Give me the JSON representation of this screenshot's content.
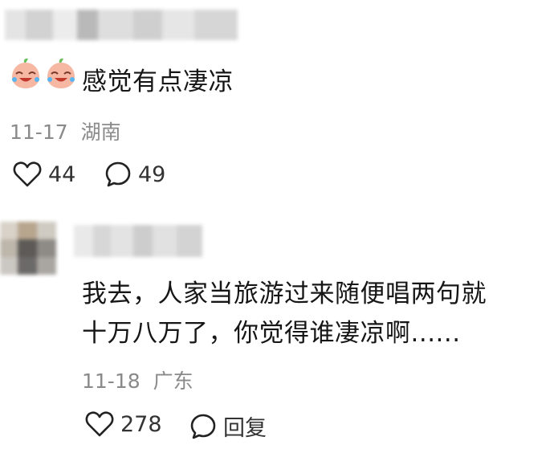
{
  "comment1": {
    "emoji": "crying-laughing-peach-emoji",
    "text": "感觉有点凄凉",
    "date": "11-17",
    "location": "湖南",
    "likes": "44",
    "replies": "49"
  },
  "comment2": {
    "lines": [
      "我去，人家当旅游过来随便唱两句就",
      "十万八万了，你觉得谁凄凉啊......"
    ],
    "date": "11-18",
    "location": "广东",
    "likes": "278",
    "reply_label": "回复"
  },
  "icons": {
    "like": "heart-outline-icon",
    "comment": "speech-bubble-icon"
  }
}
